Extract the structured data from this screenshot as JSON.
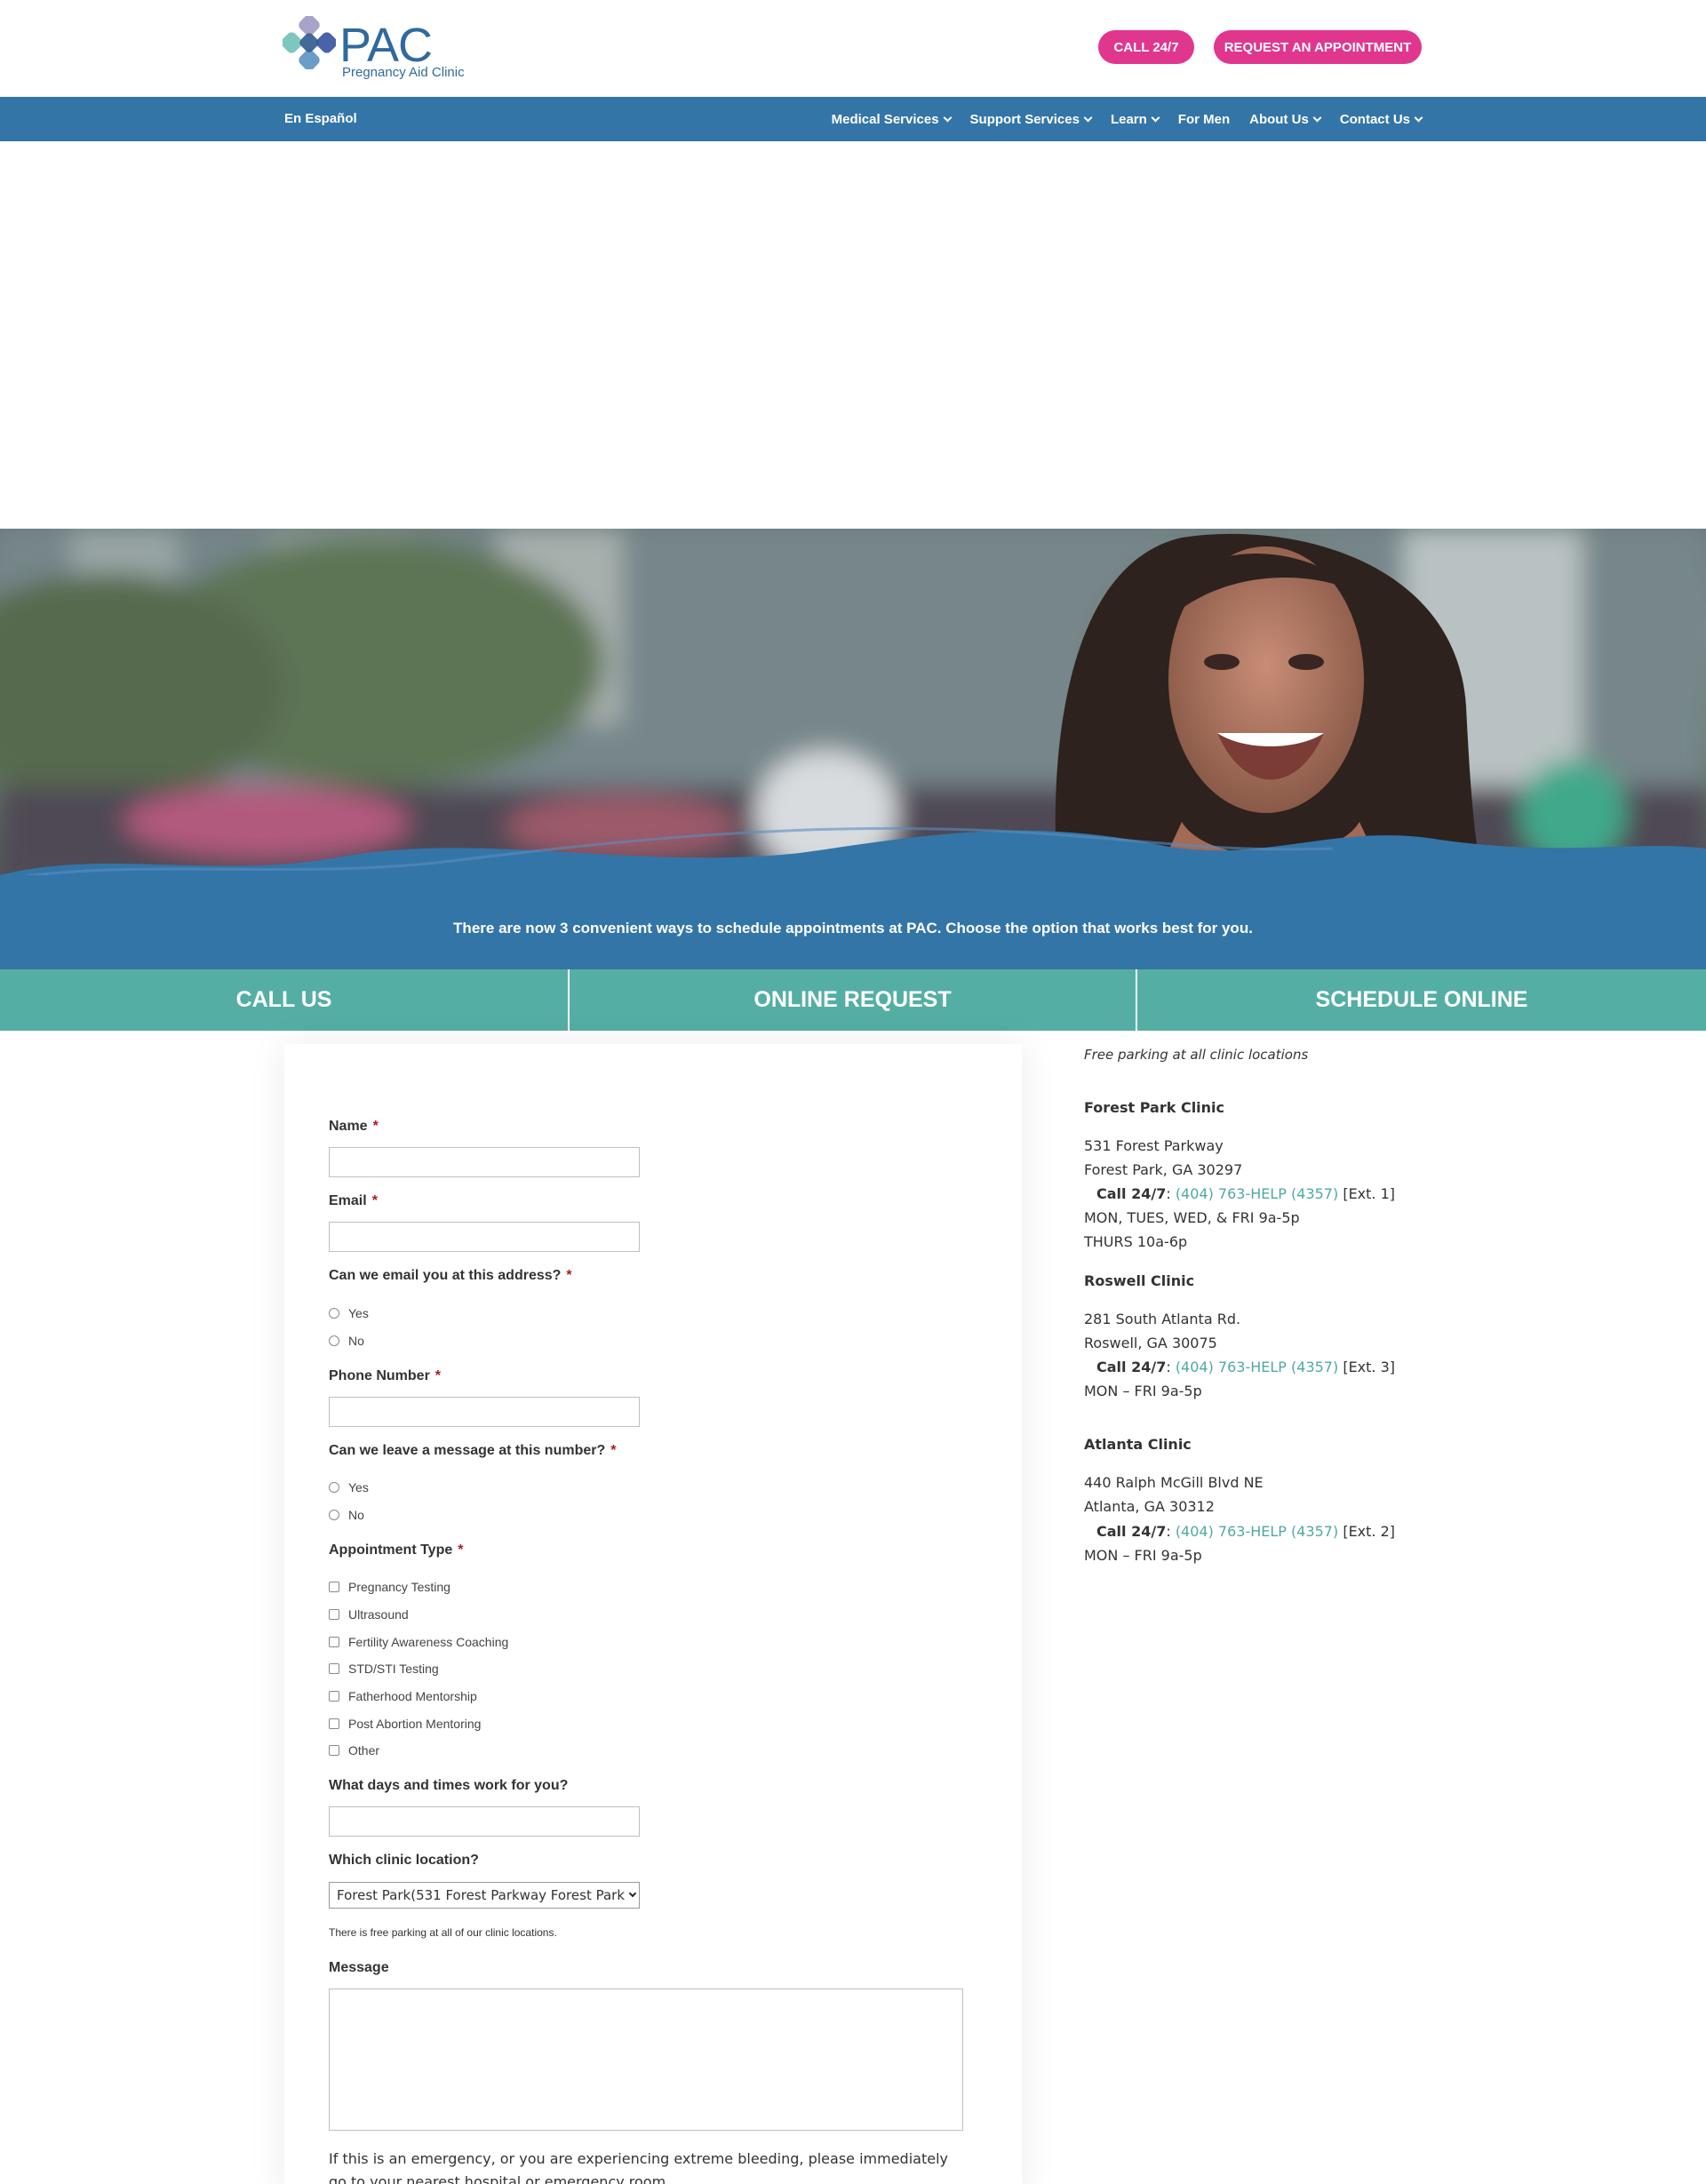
{
  "header": {
    "logo_text": "PAC",
    "logo_sub": "Pregnancy Aid Clinic",
    "call_btn": "CALL 24/7",
    "appt_btn": "REQUEST AN APPOINTMENT"
  },
  "nav": {
    "espanol": "En Español",
    "items": [
      {
        "label": "Medical Services",
        "dropdown": true
      },
      {
        "label": "Support Services",
        "dropdown": true
      },
      {
        "label": "Learn",
        "dropdown": true
      },
      {
        "label": "For Men",
        "dropdown": false
      },
      {
        "label": "About Us",
        "dropdown": true
      },
      {
        "label": "Contact Us",
        "dropdown": true
      }
    ]
  },
  "band": {
    "text": "There are now 3 convenient ways to schedule appointments at PAC. Choose the option that works best for you."
  },
  "tabs": [
    "CALL US",
    "ONLINE REQUEST",
    "SCHEDULE ONLINE"
  ],
  "form": {
    "name_label": "Name",
    "email_label": "Email",
    "email_ok_label": "Can we email you at this address?",
    "phone_label": "Phone Number",
    "leave_msg_label": "Can we leave a message at this number?",
    "yes": "Yes",
    "no": "No",
    "appt_type_label": "Appointment Type",
    "appt_types": [
      "Pregnancy Testing",
      "Ultrasound",
      "Fertility Awareness Coaching",
      "STD/STI Testing",
      "Fatherhood Mentorship",
      "Post Abortion Mentoring",
      "Other"
    ],
    "days_label": "What days and times work for you?",
    "location_label": "Which clinic location?",
    "location_selected": "Forest Park(531 Forest Parkway Forest Park",
    "parking_note": "There is free parking at all of our clinic locations.",
    "message_label": "Message",
    "emergency_text": "If this is an emergency, or you are experiencing extreme bleeding, please immediately go to your nearest hospital or emergency room."
  },
  "sidebar": {
    "parking": "Free parking at all clinic locations",
    "call_label": "Call 24/7",
    "phone": "(404) 763-HELP (4357)",
    "clinics": [
      {
        "name": "Forest Park Clinic",
        "addr1": "531 Forest Parkway",
        "addr2": "Forest Park, GA 30297",
        "ext": "[Ext. 1]",
        "hours1": "MON, TUES, WED, & FRI 9a-5p",
        "hours2": "THURS 10a-6p"
      },
      {
        "name": "Roswell Clinic",
        "addr1": "281 South Atlanta Rd.",
        "addr2": "Roswell, GA 30075",
        "ext": "[Ext. 3]",
        "hours1": "MON – FRI 9a-5p"
      },
      {
        "name": "Atlanta Clinic",
        "addr1": "440 Ralph McGill Blvd NE",
        "addr2": "Atlanta, GA 30312",
        "ext": "[Ext. 2]",
        "hours1": "MON – FRI 9a-5p"
      }
    ]
  },
  "colors": {
    "primary_blue": "#3475a8",
    "teal": "#55aea4",
    "magenta": "#e0368e",
    "link_teal": "#4fa9a4"
  }
}
